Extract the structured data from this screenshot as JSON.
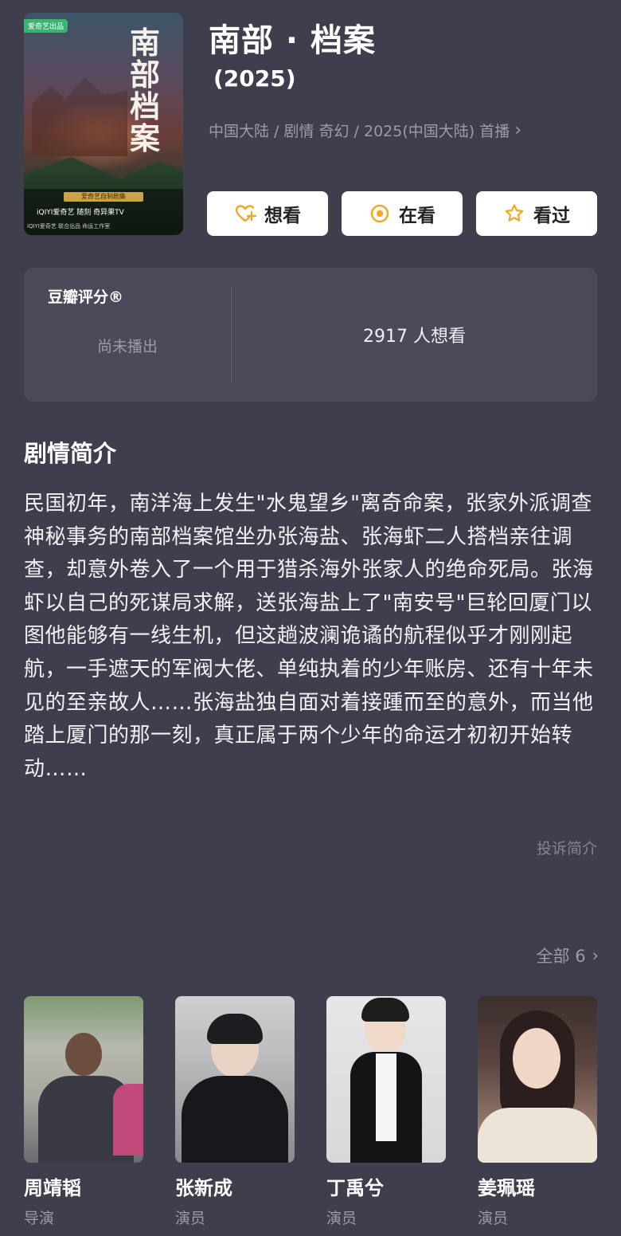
{
  "poster": {
    "badge": "爱奇艺出品",
    "title_art": "南部档案",
    "banner": "爱奇艺自制剧集",
    "logos": "iQIYI爱奇艺  随刻  奇异果TV",
    "small_print": "iQIYI爱奇艺   联合出品   命运工作室"
  },
  "movie": {
    "title": "南部 · 档案",
    "year": "(2025)",
    "meta": "中国大陆 / 剧情 奇幻 / 2025(中国大陆) 首播",
    "meta_chevron": "›"
  },
  "actions": {
    "want": "想看",
    "watching": "在看",
    "watched": "看过",
    "want_icon": "heart-plus-icon",
    "watching_icon": "target-icon",
    "watched_icon": "star-icon",
    "accent": "#f5a623"
  },
  "rating": {
    "label": "豆瓣评分®",
    "status": "尚未播出",
    "wish_count": "2917 人想看"
  },
  "synopsis": {
    "title": "剧情简介",
    "text": "民国初年，南洋海上发生\"水鬼望乡\"离奇命案，张家外派调查神秘事务的南部档案馆坐办张海盐、张海虾二人搭档亲往调查，却意外卷入了一个用于猎杀海外张家人的绝命死局。张海虾以自己的死谋局求解，送张海盐上了\"南安号\"巨轮回厦门以图他能够有一线生机，但这趟波澜诡谲的航程似乎才刚刚起航，一手遮天的军阀大佬、单纯执着的少年账房、还有十年未见的至亲故人……张海盐独自面对着接踵而至的意外，而当他踏上厦门的那一刻，真正属于两个少年的命运才初初开始转动……",
    "complain": "投诉简介"
  },
  "cast": {
    "all_label": "全部 6",
    "chevron": "›",
    "members": [
      {
        "name": "周靖韬",
        "role": "导演"
      },
      {
        "name": "张新成",
        "role": "演员"
      },
      {
        "name": "丁禹兮",
        "role": "演员"
      },
      {
        "name": "姜珮瑶",
        "role": "演员"
      }
    ]
  }
}
